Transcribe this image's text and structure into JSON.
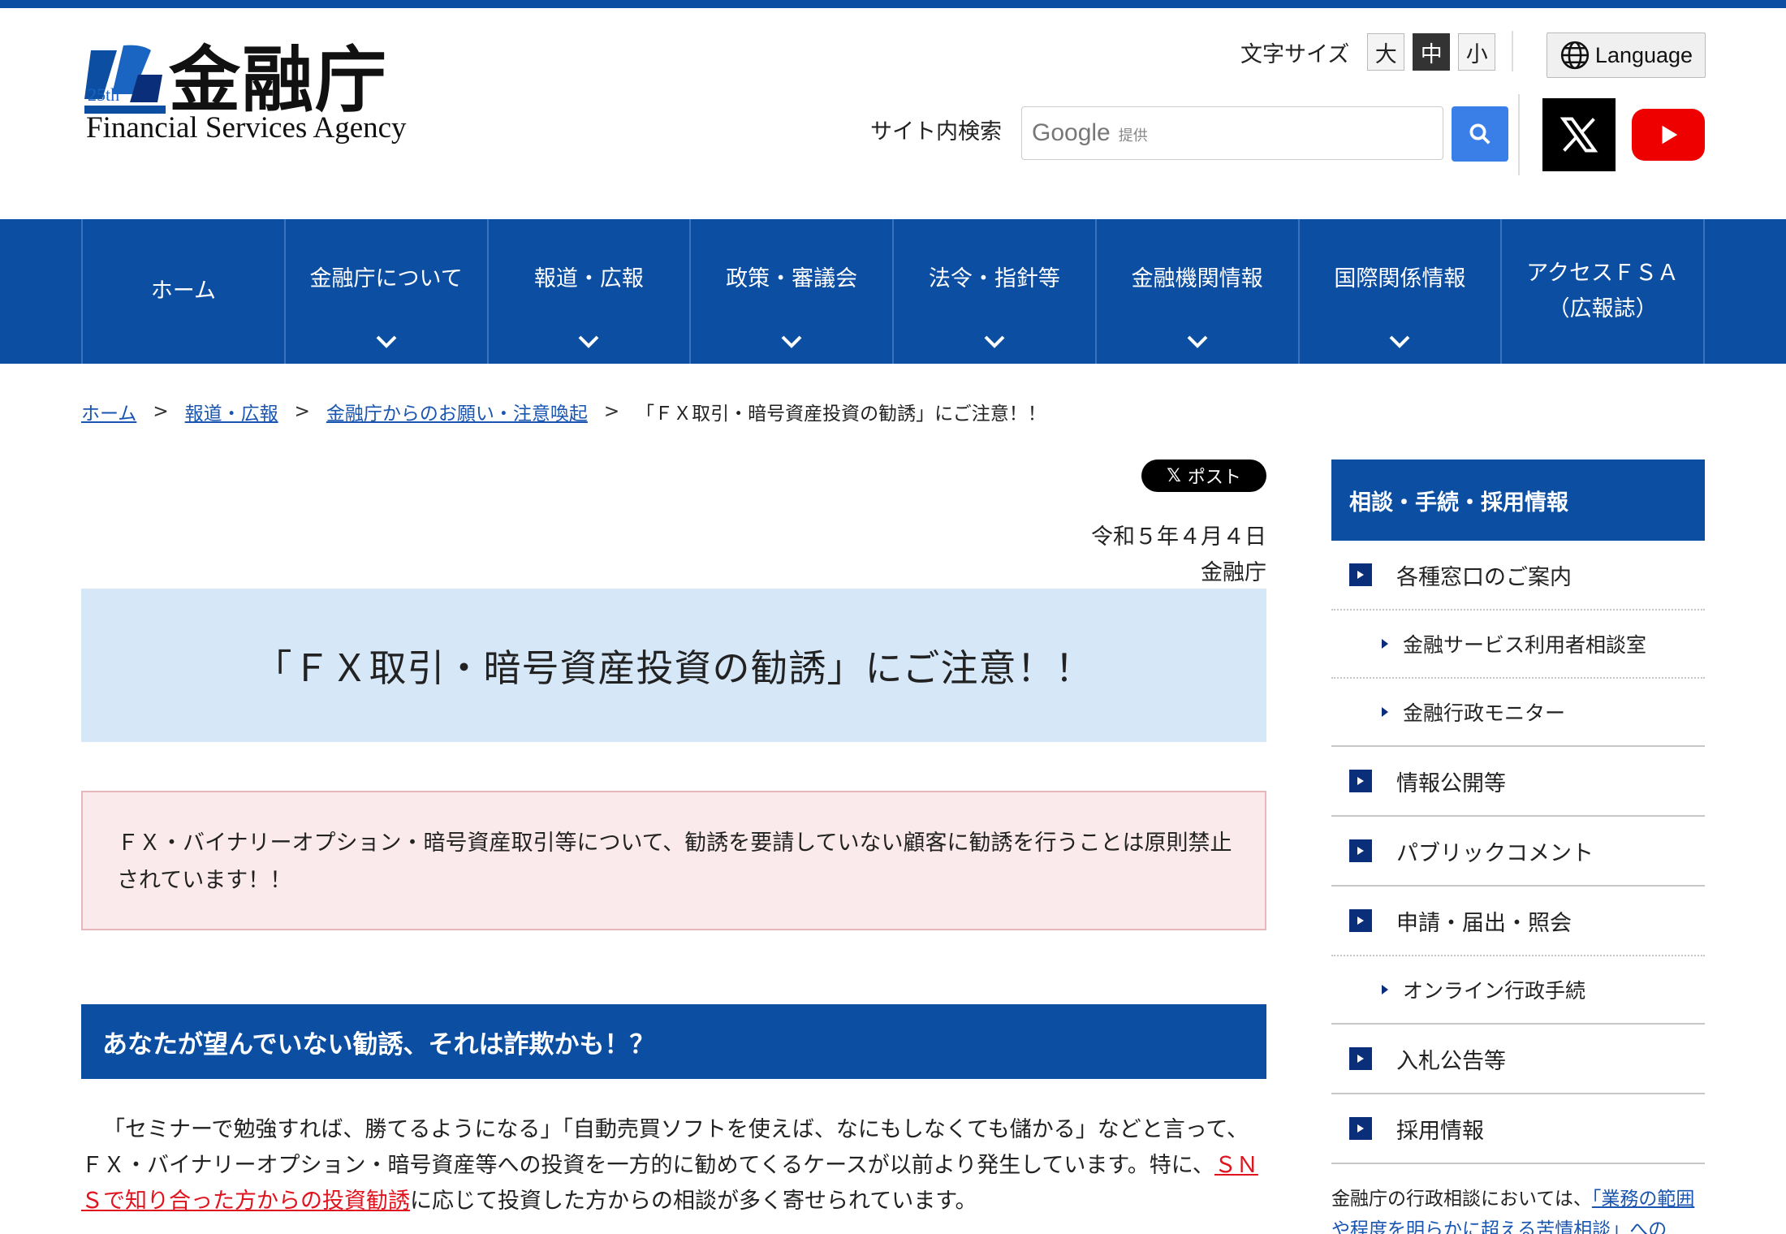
{
  "header": {
    "logo_mark_text": "25th",
    "logo_text": "金融庁",
    "logo_subtitle": "Financial Services Agency",
    "font_size_label": "文字サイズ",
    "font_sizes": [
      "大",
      "中",
      "小"
    ],
    "font_size_selected": "中",
    "language_label": "Language",
    "search_label": "サイト内検索",
    "search_placeholder_brand": "Google",
    "search_placeholder_suffix": "提供"
  },
  "nav": {
    "items": [
      {
        "label": "ホーム"
      },
      {
        "label": "金融庁について"
      },
      {
        "label": "報道・広報"
      },
      {
        "label": "政策・審議会"
      },
      {
        "label": "法令・指針等"
      },
      {
        "label": "金融機関情報"
      },
      {
        "label": "国際関係情報"
      },
      {
        "label_line1": "アクセスＦＳＡ",
        "label_line2": "（広報誌）"
      }
    ]
  },
  "breadcrumb": {
    "items": [
      "ホーム",
      "報道・広報",
      "金融庁からのお願い・注意喚起"
    ],
    "separator": ">",
    "current": "「ＦＸ取引・暗号資産投資の勧誘」にご注意！！"
  },
  "main": {
    "post_button": "ポスト",
    "date": "令和５年４月４日",
    "issuer": "金融庁",
    "title": "「ＦＸ取引・暗号資産投資の勧誘」にご注意！！",
    "notice": "ＦＸ・バイナリーオプション・暗号資産取引等について、勧誘を要請していない顧客に勧誘を行うことは原則禁止されています！！",
    "section_heading": "あなたが望んでいない勧誘、それは詐欺かも！？",
    "body_part1": "「セミナーで勉強すれば、勝てるようになる」「自動売買ソフトを使えば、なにもしなくても儲かる」などと言って、ＦＸ・バイナリーオプション・暗号資産等への投資を一方的に勧めてくるケースが以前より発生しています。特に、",
    "body_highlight": "ＳＮＳで知り合った方からの投資勧誘",
    "body_part2": "に応じて投資した方からの相談が多く寄せられています。"
  },
  "sidebar": {
    "heading": "相談・手続・採用情報",
    "items": [
      {
        "label": "各種窓口のご案内"
      },
      {
        "label": "金融サービス利用者相談室"
      },
      {
        "label": "金融行政モニター"
      },
      {
        "label": "情報公開等"
      },
      {
        "label": "パブリックコメント"
      },
      {
        "label": "申請・届出・照会"
      },
      {
        "label": "オンライン行政手続"
      },
      {
        "label": "入札公告等"
      },
      {
        "label": "採用情報"
      }
    ],
    "note_prefix": "金融庁の行政相談においては、",
    "note_link": "「業務の範囲や程度を明らかに超える苦情相談」への"
  },
  "colors": {
    "brand_blue": "#0b4ea2",
    "title_bg": "#d6e7f8",
    "notice_bg": "#fbeaec",
    "highlight_red": "#e0141e",
    "link": "#1a55b0"
  }
}
